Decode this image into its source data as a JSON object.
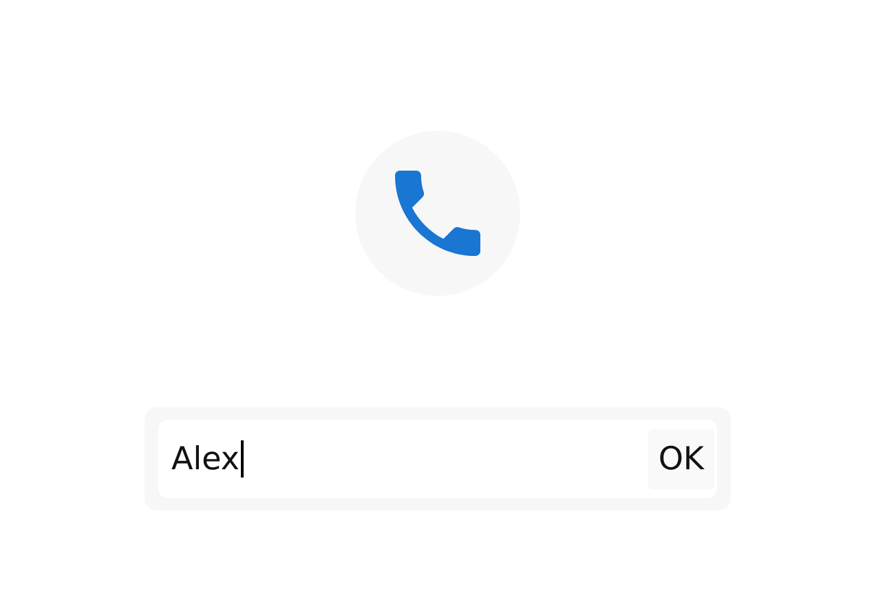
{
  "name_field": {
    "value": "Alex",
    "focused": true
  },
  "button": {
    "label": "OK"
  }
}
